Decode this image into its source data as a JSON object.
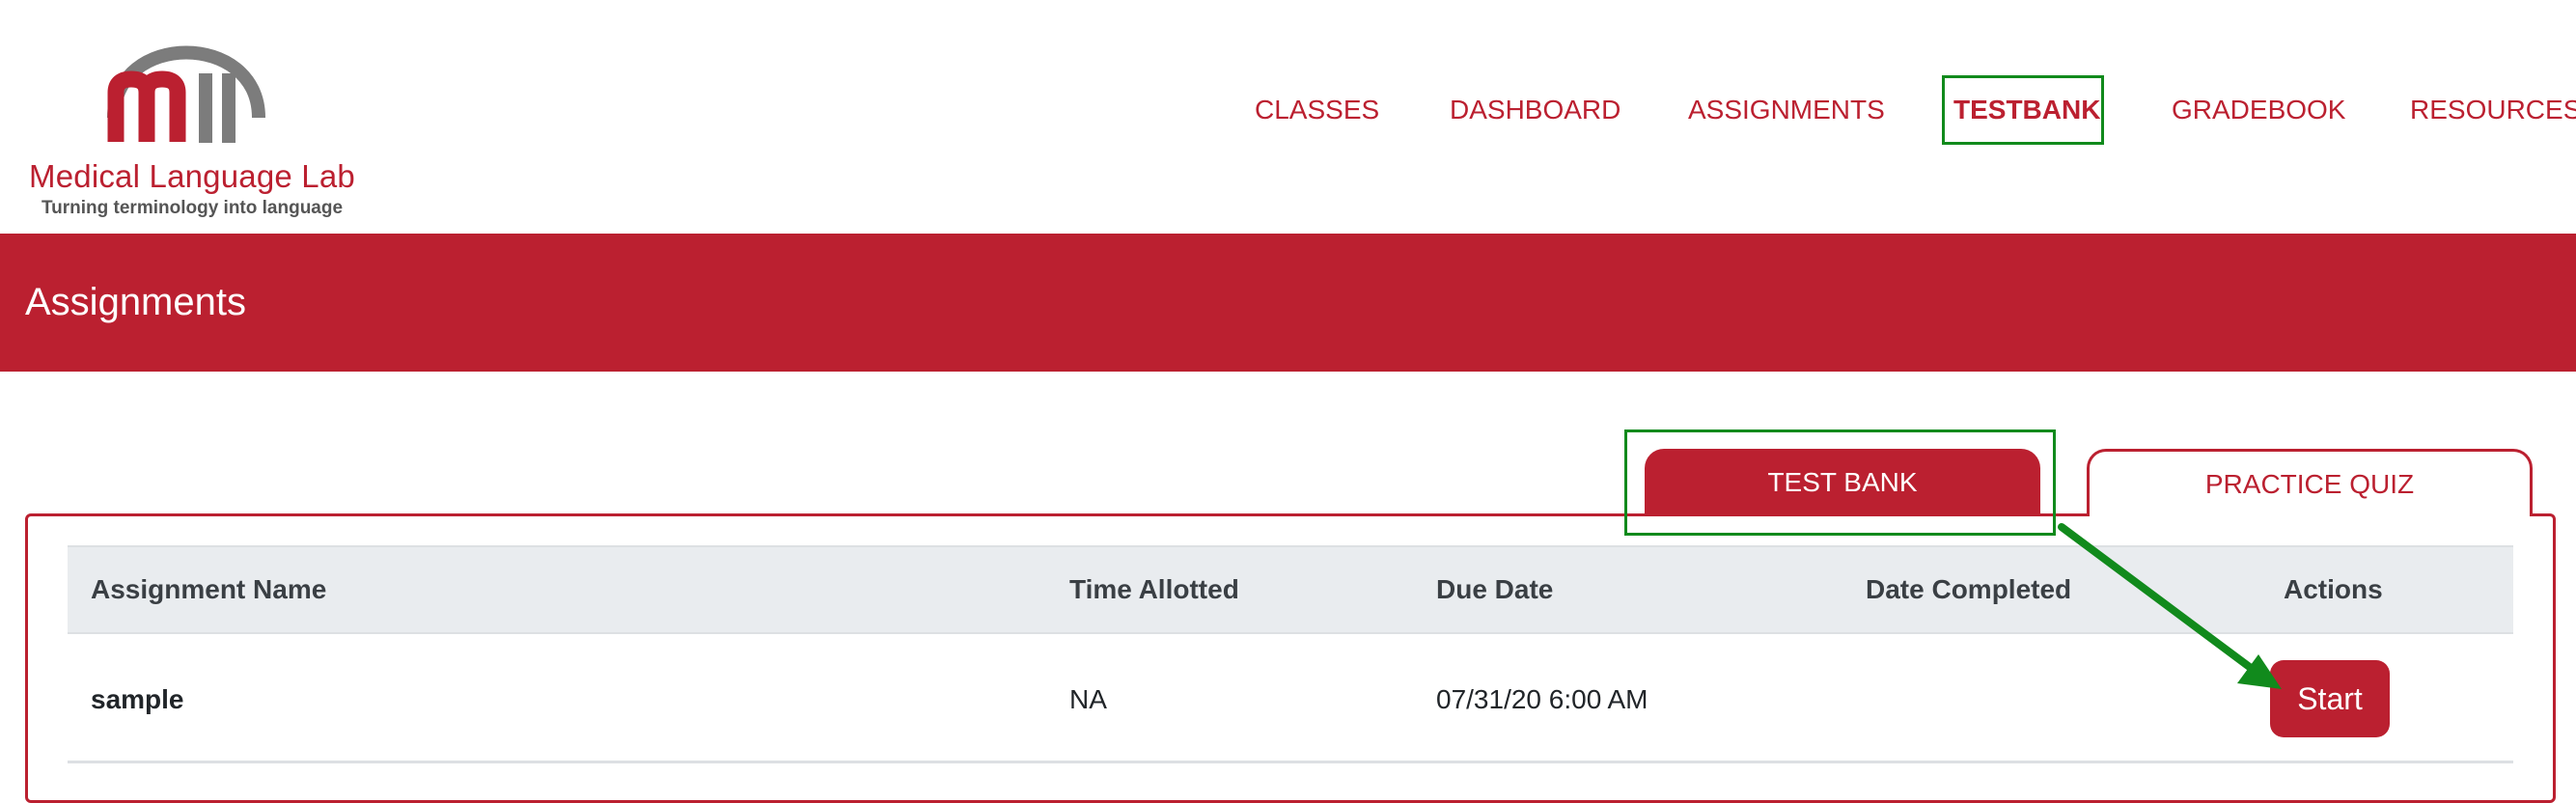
{
  "logo": {
    "name": "Medical Language Lab",
    "tagline": "Turning terminology into language"
  },
  "nav": {
    "items": [
      {
        "label": "CLASSES"
      },
      {
        "label": "DASHBOARD"
      },
      {
        "label": "ASSIGNMENTS"
      },
      {
        "label": "TESTBANK"
      },
      {
        "label": "GRADEBOOK"
      },
      {
        "label": "RESOURCES"
      }
    ],
    "active": "TESTBANK"
  },
  "page": {
    "title": "Assignments"
  },
  "tabs": {
    "test_bank": "TEST BANK",
    "practice_quiz": "PRACTICE QUIZ"
  },
  "table": {
    "columns": [
      "Assignment Name",
      "Time Allotted",
      "Due Date",
      "Date Completed",
      "Actions"
    ],
    "rows": [
      {
        "name": "sample",
        "time_allotted": "NA",
        "due_date": "07/31/20 6:00 AM",
        "date_completed": "",
        "action": "Start"
      }
    ]
  },
  "colors": {
    "brand": "#bb2030",
    "highlight": "#118a1c",
    "header_bg": "#e9ecef"
  },
  "icons": {
    "logo_mark": "mll-logo-icon",
    "annotation": "arrow-icon"
  }
}
